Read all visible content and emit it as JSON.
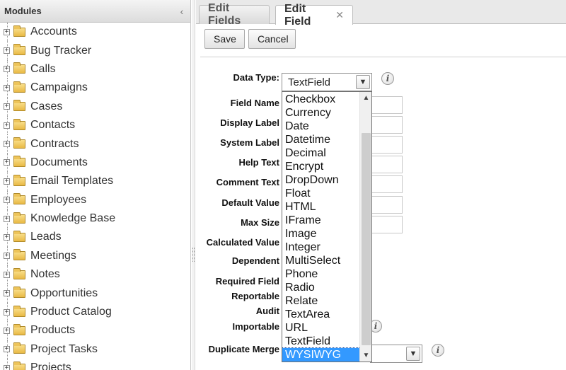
{
  "left_panel": {
    "title": "Modules",
    "collapse_glyph": "‹",
    "expand_glyph": "+",
    "modules": [
      "Accounts",
      "Bug Tracker",
      "Calls",
      "Campaigns",
      "Cases",
      "Contacts",
      "Contracts",
      "Documents",
      "Email Templates",
      "Employees",
      "Knowledge Base",
      "Leads",
      "Meetings",
      "Notes",
      "Opportunities",
      "Product Catalog",
      "Products",
      "Project Tasks",
      "Projects"
    ]
  },
  "tabs": {
    "edit_fields": "Edit Fields",
    "edit_field": "Edit Field",
    "close_glyph": "✕"
  },
  "toolbar": {
    "save_label": "Save",
    "cancel_label": "Cancel"
  },
  "form": {
    "data_type_label": "Data Type:",
    "data_type_value": "TextField",
    "field_name_label": "Field Name",
    "display_label_label": "Display Label",
    "system_label_label": "System Label",
    "help_text_label": "Help Text",
    "comment_text_label": "Comment Text",
    "default_value_label": "Default Value",
    "max_size_label": "Max Size",
    "calculated_value_label": "Calculated Value",
    "dependent_label": "Dependent",
    "required_field_label": "Required Field",
    "reportable_label": "Reportable",
    "audit_label": "Audit",
    "importable_label": "Importable",
    "duplicate_merge_label": "Duplicate Merge",
    "info_glyph": "i",
    "dropdown_arrow_glyph": "▼"
  },
  "dropdown": {
    "options": [
      "Checkbox",
      "Currency",
      "Date",
      "Datetime",
      "Decimal",
      "Encrypt",
      "DropDown",
      "Float",
      "HTML",
      "IFrame",
      "Image",
      "Integer",
      "MultiSelect",
      "Phone",
      "Radio",
      "Relate",
      "TextArea",
      "URL",
      "TextField",
      "WYSIWYG"
    ],
    "highlighted": "WYSIWYG",
    "scroll_up_glyph": "▲",
    "scroll_down_glyph": "▼"
  },
  "colors": {
    "selection": "#3399ff",
    "folder": "#e9b945"
  }
}
